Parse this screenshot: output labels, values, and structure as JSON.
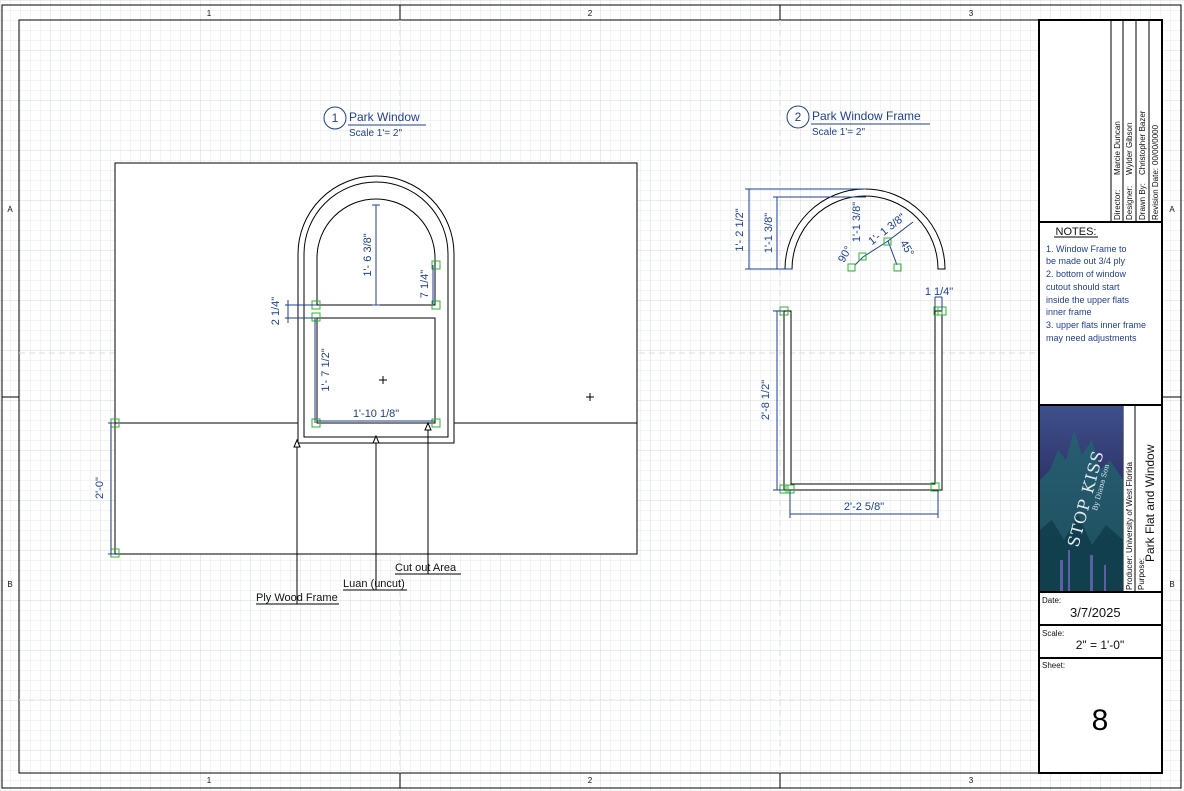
{
  "border": {
    "columns": [
      "1",
      "2",
      "3"
    ],
    "rows": [
      "A",
      "B"
    ]
  },
  "views": {
    "view1": {
      "number": "1",
      "title": "Park Window",
      "scale": "Scale 1'= 2\""
    },
    "view2": {
      "number": "2",
      "title": "Park Window Frame",
      "scale": "Scale 1'= 2\""
    }
  },
  "dimensions": {
    "arch_height": "1'- 6 3/8\"",
    "side_short": "7 1/4\"",
    "rail": "2 1/4\"",
    "cutout_height": "1'- 7 1/2\"",
    "cutout_width": "1'-10 1/8\"",
    "flat_height": "2'-0\"",
    "frame_height_outer": "1'- 2 1/2\"",
    "frame_height_inner": "1'-1 3/8\"",
    "arc_radius": "1'-1 3/8\"",
    "arc_radius_2": "1'- 1 3/8\"",
    "angle_90": "90°",
    "angle_45": "45°",
    "leg_width": "1 1/4\"",
    "leg_height": "2'-8 1/2\"",
    "base_width": "2'-2 5/8\""
  },
  "callouts": {
    "cutout": "Cut out Area",
    "luan": "Luan (uncut)",
    "ply": "Ply Wood Frame"
  },
  "title_block": {
    "director": {
      "label": "Director:",
      "value": "Marcie Duncan"
    },
    "designer": {
      "label": "Designer:",
      "value": "Wylder Gibson"
    },
    "drawn_by": {
      "label": "Drawn By:",
      "value": "Christopher Bazer"
    },
    "revision": {
      "label": "Revision Date:",
      "value": "00/00/0000"
    },
    "notes_title": "NOTES:",
    "notes": [
      "1. Window Frame to",
      "be made out 3/4 ply",
      "2. bottom of window",
      "cutout should start",
      "inside the upper flats",
      "inner frame",
      "3. upper flats inner frame",
      "may need adjustments"
    ],
    "poster_title": "STOP KISS",
    "poster_author": "By Diana Son",
    "producer": {
      "label": "Producer:",
      "value": "University of West Florida"
    },
    "purpose": {
      "label": "Purpose:",
      "value": "Park Flat and Window"
    },
    "date": {
      "label": "Date:",
      "value": "3/7/2025"
    },
    "scale": {
      "label": "Scale:",
      "value": "2\" = 1'-0\""
    },
    "sheet": {
      "label": "Sheet:",
      "value": "8"
    }
  }
}
